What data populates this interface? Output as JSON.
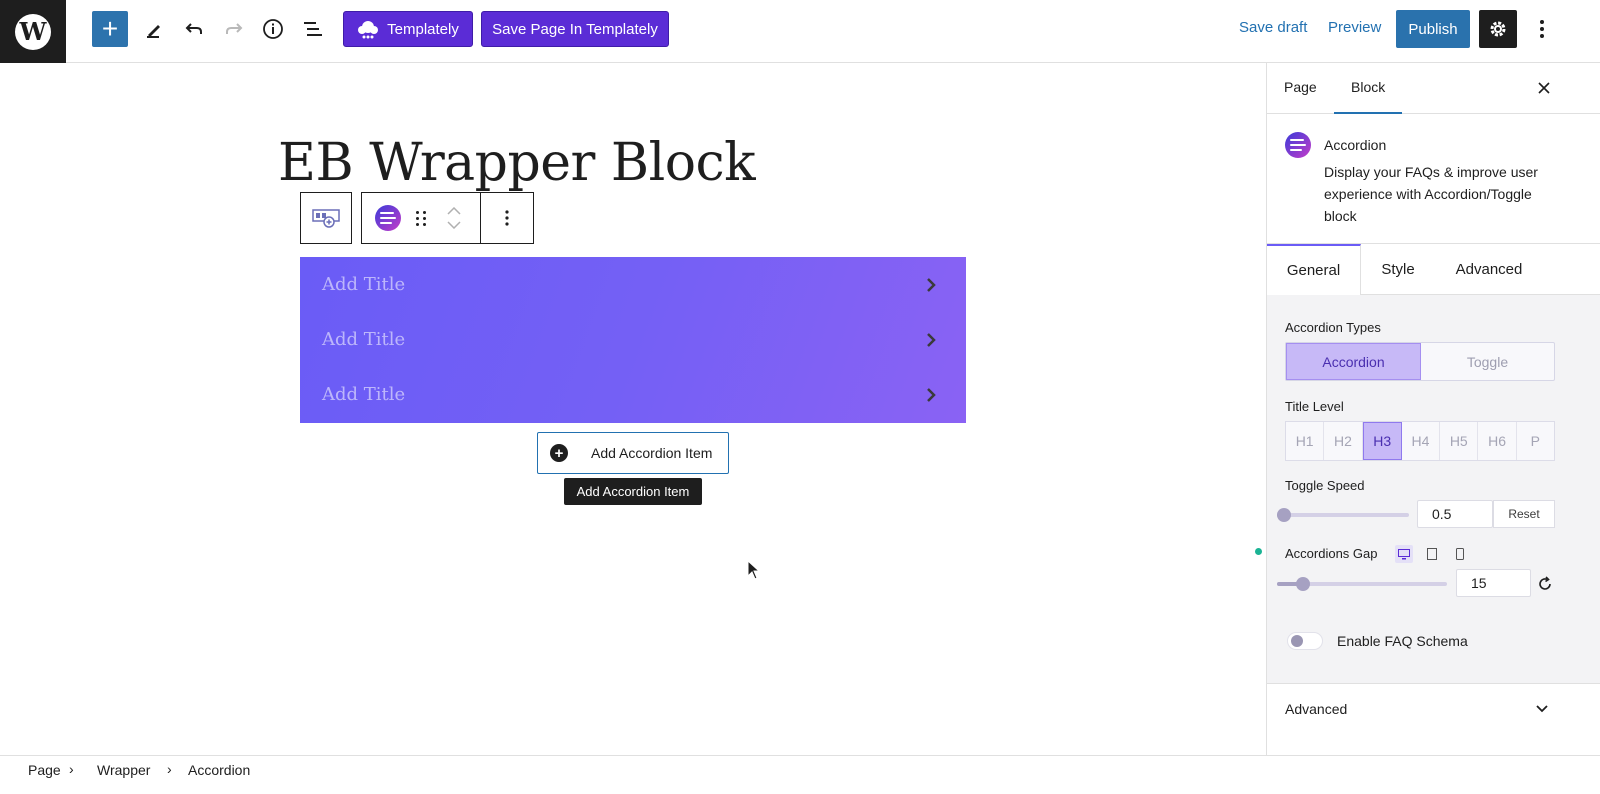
{
  "toolbar": {
    "templately_label": "Templately",
    "save_templately_label": "Save Page In Templately",
    "save_draft_label": "Save draft",
    "preview_label": "Preview",
    "publish_label": "Publish"
  },
  "canvas": {
    "page_title": "EB Wrapper Block",
    "accordion_items": [
      {
        "title": "Add Title"
      },
      {
        "title": "Add Title"
      },
      {
        "title": "Add Title"
      }
    ],
    "add_item_label": "Add Accordion Item",
    "tooltip": "Add Accordion Item"
  },
  "sidebar": {
    "tabs": [
      "Page",
      "Block"
    ],
    "block_name": "Accordion",
    "block_description": "Display your FAQs & improve user experience with Accordion/Toggle block",
    "panel_tabs": [
      "General",
      "Style",
      "Advanced"
    ],
    "accordion_types_label": "Accordion Types",
    "accordion_types": [
      "Accordion",
      "Toggle"
    ],
    "accordion_type_selected": "Accordion",
    "title_level_label": "Title Level",
    "title_levels": [
      "H1",
      "H2",
      "H3",
      "H4",
      "H5",
      "H6",
      "P"
    ],
    "title_level_selected": "H3",
    "toggle_speed_label": "Toggle Speed",
    "toggle_speed_value": "0.5",
    "toggle_speed_fraction": 0.05,
    "reset_label": "Reset",
    "accordions_gap_label": "Accordions Gap",
    "accordions_gap_value": "15",
    "accordions_gap_fraction": 0.15,
    "faq_schema_label": "Enable FAQ Schema",
    "advanced_label": "Advanced"
  },
  "breadcrumb": [
    "Page",
    "Wrapper",
    "Accordion"
  ],
  "colors": {
    "accent": "#5b2cd6",
    "publish": "#2a72ad",
    "accordion_bg": "#7460f5"
  }
}
